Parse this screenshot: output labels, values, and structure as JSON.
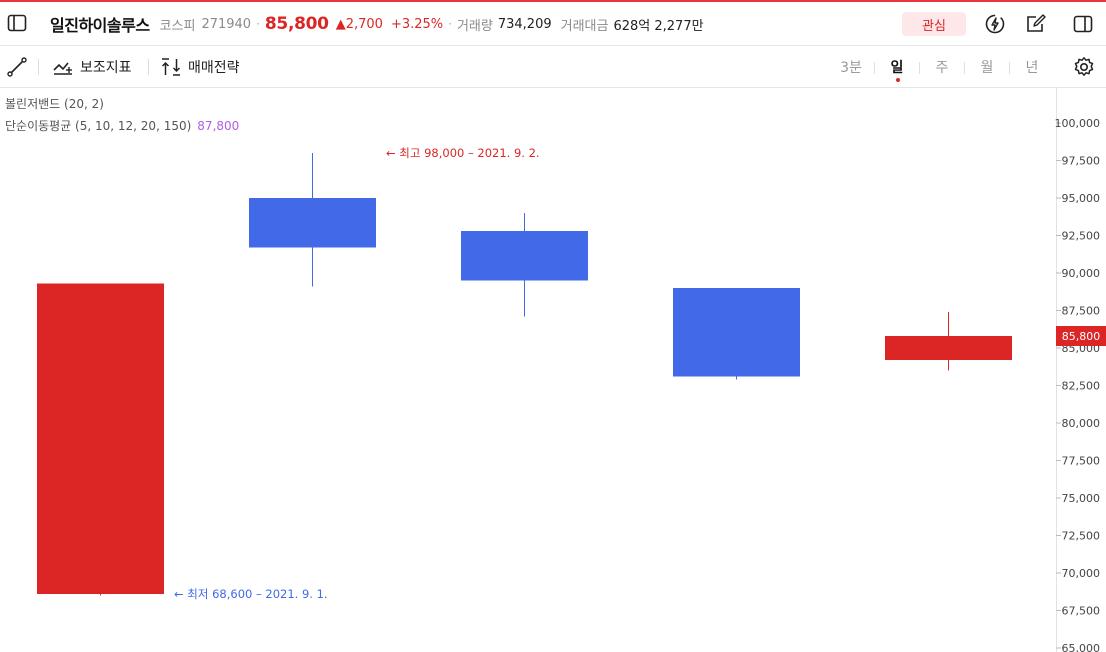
{
  "header": {
    "stock_name": "일진하이솔루스",
    "market": "코스피",
    "code": "271940",
    "price": "85,800",
    "change": "▲2,700",
    "change_pct": "+3.25%",
    "volume_label": "거래량",
    "volume": "734,209",
    "amount_label": "거래대금",
    "amount": "628억 2,277만",
    "favorite_label": "관심"
  },
  "toolbar": {
    "indicator_label": "보조지표",
    "strategy_label": "매매전략",
    "periods": [
      "3분",
      "일",
      "주",
      "월",
      "년"
    ],
    "active_period": "일"
  },
  "indicators": {
    "bollinger": "볼린저밴드 (20, 2)",
    "ma": "단순이동평균 (5, 10, 12, 20, 150)",
    "ma_value": "87,800"
  },
  "colors": {
    "up": "#dc2626",
    "down": "#4169e8",
    "ma": "#b05fe6",
    "accent": "#e8343b"
  },
  "chart_data": {
    "type": "candlestick",
    "ylim": [
      65000,
      102000
    ],
    "ticks": [
      65000,
      67500,
      70000,
      72500,
      75000,
      77500,
      80000,
      82500,
      85000,
      87500,
      90000,
      92500,
      95000,
      97500,
      100000
    ],
    "tick_labels": [
      "65,000",
      "67,500",
      "70,000",
      "72,500",
      "75,000",
      "77,500",
      "80,000",
      "82,500",
      "85,000",
      "87,500",
      "90,000",
      "92,500",
      "95,000",
      "97,500",
      "100,000"
    ],
    "candles": [
      {
        "open": 68600,
        "close": 89300,
        "high": 89300,
        "low": 68500,
        "dir": "up"
      },
      {
        "open": 95000,
        "close": 91700,
        "high": 98000,
        "low": 89100,
        "dir": "down"
      },
      {
        "open": 92800,
        "close": 89500,
        "high": 94000,
        "low": 87100,
        "dir": "down"
      },
      {
        "open": 89000,
        "close": 83100,
        "high": 89000,
        "low": 82900,
        "dir": "down"
      },
      {
        "open": 84200,
        "close": 85800,
        "high": 87400,
        "low": 83500,
        "dir": "up"
      }
    ],
    "current_price": 85800,
    "current_price_label": "85,800",
    "high_annotation": "← 최고 98,000 – 2021. 9. 2.",
    "low_annotation": "← 최저 68,600 – 2021. 9. 1.",
    "high_value": 98000,
    "low_value": 68600
  }
}
